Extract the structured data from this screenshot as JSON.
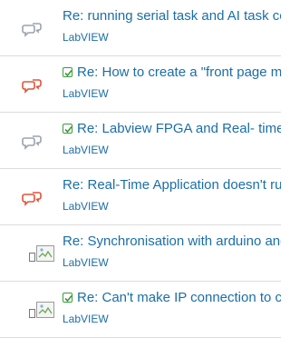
{
  "colors": {
    "link": "#1a6ea8",
    "bubble_gray": "#9aa3ad",
    "bubble_red": "#e0533a",
    "solved_green": "#3a9a3a",
    "divider": "#dcdcdc"
  },
  "threads": [
    {
      "title": "Re: running serial task and AI task cont",
      "board": "LabVIEW",
      "solved": false,
      "icon": "chat-bubbles-gray-icon"
    },
    {
      "title": "Re: How to create a \"front page men",
      "board": "LabVIEW",
      "solved": true,
      "icon": "chat-bubbles-red-icon"
    },
    {
      "title": "Re: Labview FPGA and Real- time mo",
      "board": "LabVIEW",
      "solved": true,
      "icon": "chat-bubbles-gray-icon"
    },
    {
      "title": "Re: Real-Time Application doesn't run; s",
      "board": "LabVIEW",
      "solved": false,
      "icon": "chat-bubbles-red-icon"
    },
    {
      "title": "Re: Synchronisation with arduino and L",
      "board": "LabVIEW",
      "solved": false,
      "icon": "broken-image-icon"
    },
    {
      "title": "Re: Can't make IP connection to cRIC",
      "board": "LabVIEW",
      "solved": true,
      "icon": "broken-image-icon"
    }
  ]
}
